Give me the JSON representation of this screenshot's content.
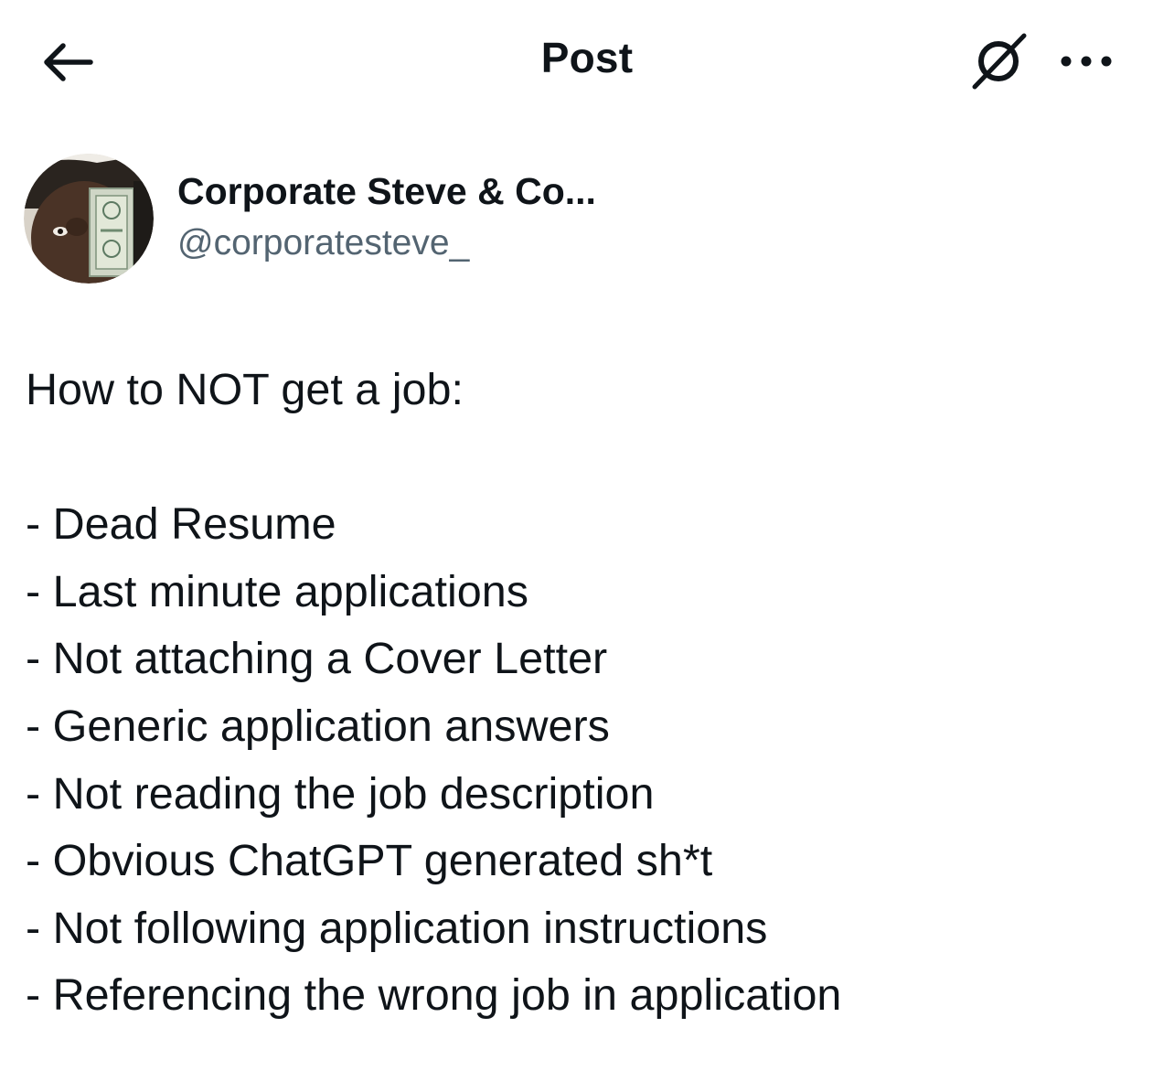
{
  "header": {
    "title": "Post",
    "back_icon": "arrow-left-icon",
    "grok_icon": "grok-icon",
    "more_icon": "more-horizontal-icon"
  },
  "author": {
    "display_name": "Corporate Steve & Co...",
    "handle": "@corporatesteve_",
    "avatar_icon": "avatar"
  },
  "post": {
    "intro": "How to NOT get a job:",
    "items": [
      "- Dead Resume",
      "- Last minute applications",
      "- Not attaching a Cover Letter",
      "- Generic application answers",
      "- Not reading the job description",
      "- Obvious ChatGPT generated sh*t",
      "- Not following application instructions",
      "- Referencing the wrong job in application"
    ]
  },
  "colors": {
    "text": "#0f1419",
    "secondary_text": "#536471",
    "background": "#ffffff"
  }
}
